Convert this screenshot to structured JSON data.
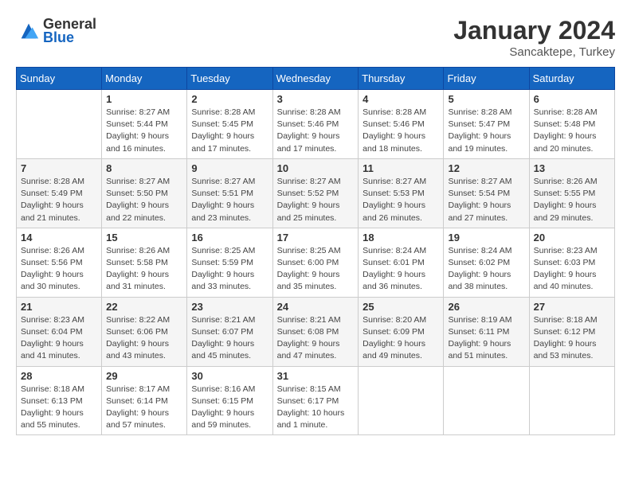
{
  "header": {
    "logo_general": "General",
    "logo_blue": "Blue",
    "month_year": "January 2024",
    "location": "Sancaktepe, Turkey"
  },
  "days_of_week": [
    "Sunday",
    "Monday",
    "Tuesday",
    "Wednesday",
    "Thursday",
    "Friday",
    "Saturday"
  ],
  "weeks": [
    [
      {
        "day": "",
        "sunrise": "",
        "sunset": "",
        "daylight": ""
      },
      {
        "day": "1",
        "sunrise": "Sunrise: 8:27 AM",
        "sunset": "Sunset: 5:44 PM",
        "daylight": "Daylight: 9 hours and 16 minutes."
      },
      {
        "day": "2",
        "sunrise": "Sunrise: 8:28 AM",
        "sunset": "Sunset: 5:45 PM",
        "daylight": "Daylight: 9 hours and 17 minutes."
      },
      {
        "day": "3",
        "sunrise": "Sunrise: 8:28 AM",
        "sunset": "Sunset: 5:46 PM",
        "daylight": "Daylight: 9 hours and 17 minutes."
      },
      {
        "day": "4",
        "sunrise": "Sunrise: 8:28 AM",
        "sunset": "Sunset: 5:46 PM",
        "daylight": "Daylight: 9 hours and 18 minutes."
      },
      {
        "day": "5",
        "sunrise": "Sunrise: 8:28 AM",
        "sunset": "Sunset: 5:47 PM",
        "daylight": "Daylight: 9 hours and 19 minutes."
      },
      {
        "day": "6",
        "sunrise": "Sunrise: 8:28 AM",
        "sunset": "Sunset: 5:48 PM",
        "daylight": "Daylight: 9 hours and 20 minutes."
      }
    ],
    [
      {
        "day": "7",
        "sunrise": "Sunrise: 8:28 AM",
        "sunset": "Sunset: 5:49 PM",
        "daylight": "Daylight: 9 hours and 21 minutes."
      },
      {
        "day": "8",
        "sunrise": "Sunrise: 8:27 AM",
        "sunset": "Sunset: 5:50 PM",
        "daylight": "Daylight: 9 hours and 22 minutes."
      },
      {
        "day": "9",
        "sunrise": "Sunrise: 8:27 AM",
        "sunset": "Sunset: 5:51 PM",
        "daylight": "Daylight: 9 hours and 23 minutes."
      },
      {
        "day": "10",
        "sunrise": "Sunrise: 8:27 AM",
        "sunset": "Sunset: 5:52 PM",
        "daylight": "Daylight: 9 hours and 25 minutes."
      },
      {
        "day": "11",
        "sunrise": "Sunrise: 8:27 AM",
        "sunset": "Sunset: 5:53 PM",
        "daylight": "Daylight: 9 hours and 26 minutes."
      },
      {
        "day": "12",
        "sunrise": "Sunrise: 8:27 AM",
        "sunset": "Sunset: 5:54 PM",
        "daylight": "Daylight: 9 hours and 27 minutes."
      },
      {
        "day": "13",
        "sunrise": "Sunrise: 8:26 AM",
        "sunset": "Sunset: 5:55 PM",
        "daylight": "Daylight: 9 hours and 29 minutes."
      }
    ],
    [
      {
        "day": "14",
        "sunrise": "Sunrise: 8:26 AM",
        "sunset": "Sunset: 5:56 PM",
        "daylight": "Daylight: 9 hours and 30 minutes."
      },
      {
        "day": "15",
        "sunrise": "Sunrise: 8:26 AM",
        "sunset": "Sunset: 5:58 PM",
        "daylight": "Daylight: 9 hours and 31 minutes."
      },
      {
        "day": "16",
        "sunrise": "Sunrise: 8:25 AM",
        "sunset": "Sunset: 5:59 PM",
        "daylight": "Daylight: 9 hours and 33 minutes."
      },
      {
        "day": "17",
        "sunrise": "Sunrise: 8:25 AM",
        "sunset": "Sunset: 6:00 PM",
        "daylight": "Daylight: 9 hours and 35 minutes."
      },
      {
        "day": "18",
        "sunrise": "Sunrise: 8:24 AM",
        "sunset": "Sunset: 6:01 PM",
        "daylight": "Daylight: 9 hours and 36 minutes."
      },
      {
        "day": "19",
        "sunrise": "Sunrise: 8:24 AM",
        "sunset": "Sunset: 6:02 PM",
        "daylight": "Daylight: 9 hours and 38 minutes."
      },
      {
        "day": "20",
        "sunrise": "Sunrise: 8:23 AM",
        "sunset": "Sunset: 6:03 PM",
        "daylight": "Daylight: 9 hours and 40 minutes."
      }
    ],
    [
      {
        "day": "21",
        "sunrise": "Sunrise: 8:23 AM",
        "sunset": "Sunset: 6:04 PM",
        "daylight": "Daylight: 9 hours and 41 minutes."
      },
      {
        "day": "22",
        "sunrise": "Sunrise: 8:22 AM",
        "sunset": "Sunset: 6:06 PM",
        "daylight": "Daylight: 9 hours and 43 minutes."
      },
      {
        "day": "23",
        "sunrise": "Sunrise: 8:21 AM",
        "sunset": "Sunset: 6:07 PM",
        "daylight": "Daylight: 9 hours and 45 minutes."
      },
      {
        "day": "24",
        "sunrise": "Sunrise: 8:21 AM",
        "sunset": "Sunset: 6:08 PM",
        "daylight": "Daylight: 9 hours and 47 minutes."
      },
      {
        "day": "25",
        "sunrise": "Sunrise: 8:20 AM",
        "sunset": "Sunset: 6:09 PM",
        "daylight": "Daylight: 9 hours and 49 minutes."
      },
      {
        "day": "26",
        "sunrise": "Sunrise: 8:19 AM",
        "sunset": "Sunset: 6:11 PM",
        "daylight": "Daylight: 9 hours and 51 minutes."
      },
      {
        "day": "27",
        "sunrise": "Sunrise: 8:18 AM",
        "sunset": "Sunset: 6:12 PM",
        "daylight": "Daylight: 9 hours and 53 minutes."
      }
    ],
    [
      {
        "day": "28",
        "sunrise": "Sunrise: 8:18 AM",
        "sunset": "Sunset: 6:13 PM",
        "daylight": "Daylight: 9 hours and 55 minutes."
      },
      {
        "day": "29",
        "sunrise": "Sunrise: 8:17 AM",
        "sunset": "Sunset: 6:14 PM",
        "daylight": "Daylight: 9 hours and 57 minutes."
      },
      {
        "day": "30",
        "sunrise": "Sunrise: 8:16 AM",
        "sunset": "Sunset: 6:15 PM",
        "daylight": "Daylight: 9 hours and 59 minutes."
      },
      {
        "day": "31",
        "sunrise": "Sunrise: 8:15 AM",
        "sunset": "Sunset: 6:17 PM",
        "daylight": "Daylight: 10 hours and 1 minute."
      },
      {
        "day": "",
        "sunrise": "",
        "sunset": "",
        "daylight": ""
      },
      {
        "day": "",
        "sunrise": "",
        "sunset": "",
        "daylight": ""
      },
      {
        "day": "",
        "sunrise": "",
        "sunset": "",
        "daylight": ""
      }
    ]
  ]
}
